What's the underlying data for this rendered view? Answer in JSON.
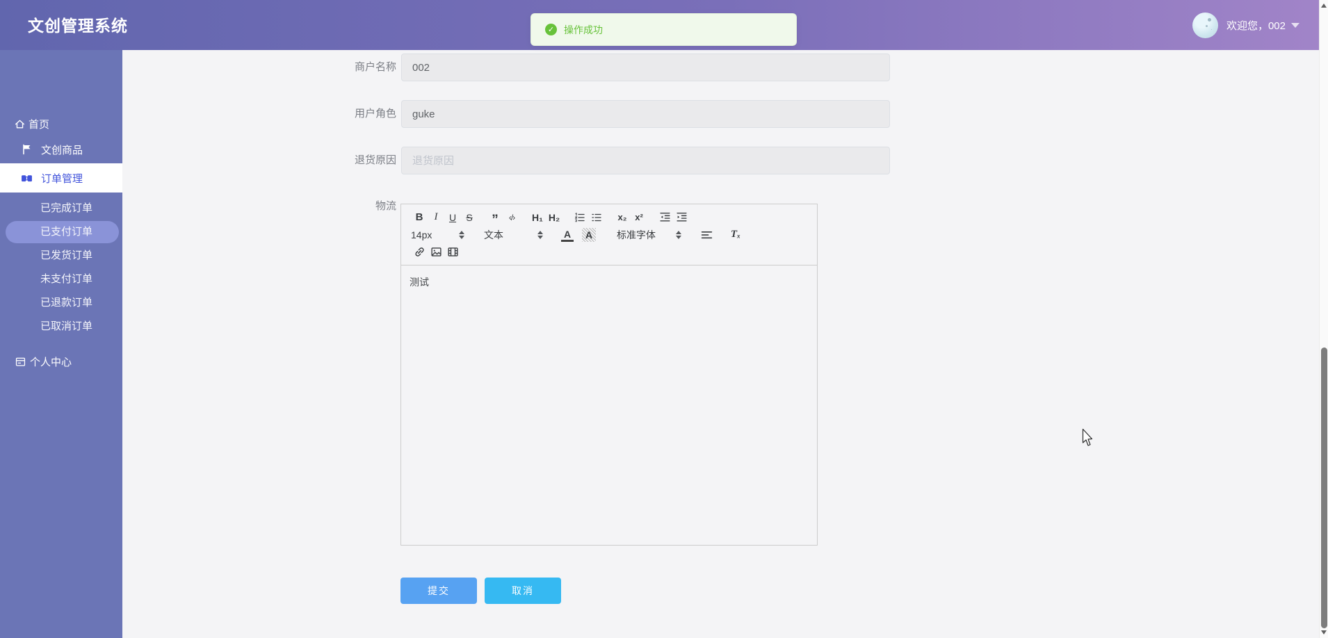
{
  "app": {
    "title": "文创管理系统"
  },
  "header": {
    "welcome": "欢迎您，002"
  },
  "toast": {
    "text": "操作成功",
    "check": "✓"
  },
  "sidebar": {
    "home": "首页",
    "products": "文创商品",
    "orders": "订单管理",
    "submenu": [
      {
        "label": "已完成订单",
        "active": false
      },
      {
        "label": "已支付订单",
        "active": true
      },
      {
        "label": "已发货订单",
        "active": false
      },
      {
        "label": "未支付订单",
        "active": false
      },
      {
        "label": "已退款订单",
        "active": false
      },
      {
        "label": "已取消订单",
        "active": false
      }
    ],
    "profile": "个人中心"
  },
  "form": {
    "fields": [
      {
        "label": "商户名称",
        "value": "002"
      },
      {
        "label": "用户角色",
        "value": "guke"
      },
      {
        "label": "退货原因",
        "value": "",
        "placeholder": "退货原因"
      },
      {
        "label": "物流"
      }
    ],
    "buttons": {
      "submit": "提交",
      "cancel": "取消"
    }
  },
  "editor": {
    "toolbar": {
      "bold": "B",
      "italic": "I",
      "underline": "U",
      "strike": "S",
      "blockquote": "”",
      "code": "‹/›",
      "h1": "H₁",
      "h2": "H₂",
      "subscript": "x₂",
      "superscript": "x²",
      "size_value": "14px",
      "style_value": "文本",
      "font_value": "标准字体",
      "color_letter": "A",
      "background_letter": "A",
      "clean": "Tₓ"
    },
    "content": "测试"
  },
  "colors": {
    "header_left": "#6166ae",
    "header_right": "#a184c8",
    "sidebar": "#6b75b6",
    "active_item_text": "#4254db",
    "active_pill": "#8a93d8",
    "success": "#67c23a",
    "submit_button": "#57a2f2",
    "cancel_button": "#36b9f2"
  }
}
